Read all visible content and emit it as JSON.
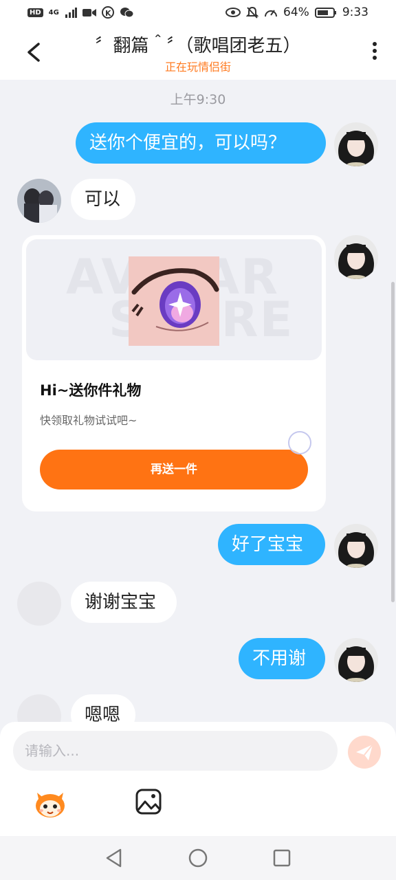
{
  "status_bar": {
    "hd": "HD",
    "network": "4G",
    "battery_percent": "64%",
    "time": "9:33",
    "icons": [
      "signal-icon",
      "video-icon",
      "k-app-icon",
      "wechat-icon",
      "eye-icon",
      "mute-icon",
      "speed-icon",
      "battery-icon"
    ]
  },
  "header": {
    "title": "〞翻篇＾〞（歌唱团老五）",
    "subtitle": "正在玩情侣街",
    "subtitle_color": "#ff7a1f"
  },
  "chat": {
    "timestamp": "上午9:30",
    "messages": [
      {
        "side": "out",
        "text": "送你个便宜的，可以吗？"
      },
      {
        "side": "in",
        "text": "可以"
      },
      {
        "side": "out",
        "type": "gift_card"
      },
      {
        "side": "out",
        "text": "好了宝宝"
      },
      {
        "side": "in",
        "text": "谢谢宝宝"
      },
      {
        "side": "out",
        "text": "不用谢"
      },
      {
        "side": "in",
        "text": "嗯嗯"
      }
    ],
    "gift_card": {
      "watermark_line1": "AVATAR",
      "watermark_line2": "STORE",
      "title": "Hi~送你件礼物",
      "description": "快领取礼物试试吧~",
      "button": "再送一件"
    },
    "colors": {
      "outgoing_bubble": "#2fb4ff",
      "incoming_bubble": "#ffffff",
      "gift_button": "#ff7313"
    }
  },
  "input": {
    "placeholder": "请输入..."
  },
  "nav": {
    "icons": [
      "back-triangle-icon",
      "home-circle-icon",
      "recents-square-icon"
    ]
  }
}
